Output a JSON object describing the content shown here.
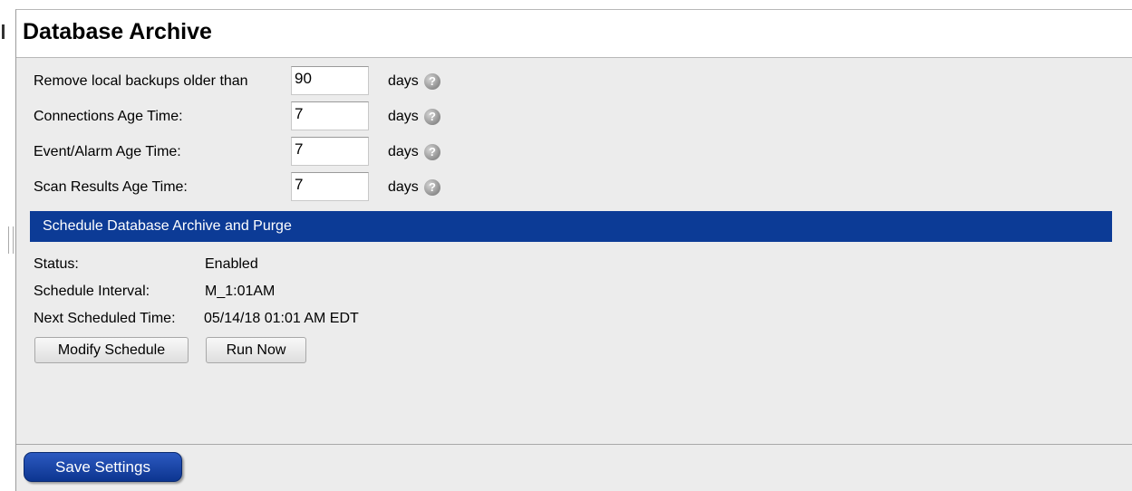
{
  "page": {
    "title": "Database Archive"
  },
  "settings": {
    "rows": [
      {
        "label": "Remove local backups older than",
        "value": "90",
        "unit": "days"
      },
      {
        "label": "Connections Age Time:",
        "value": "7",
        "unit": "days"
      },
      {
        "label": "Event/Alarm Age Time:",
        "value": "7",
        "unit": "days"
      },
      {
        "label": "Scan Results Age Time:",
        "value": "7",
        "unit": "days"
      }
    ]
  },
  "schedule": {
    "header": "Schedule Database Archive and Purge",
    "status_label": "Status:",
    "status_value": "Enabled",
    "interval_label": "Schedule Interval:",
    "interval_value": "M_1:01AM",
    "next_label": "Next Scheduled Time:",
    "next_value": "05/14/18 01:01 AM EDT",
    "modify_label": "Modify Schedule",
    "run_label": "Run Now"
  },
  "footer": {
    "save_label": "Save Settings"
  },
  "colors": {
    "header_blue": "#0c3b96",
    "save_blue": "#1a44a8",
    "panel_bg": "#ececec"
  },
  "icons": {
    "help": "help-question-icon"
  }
}
